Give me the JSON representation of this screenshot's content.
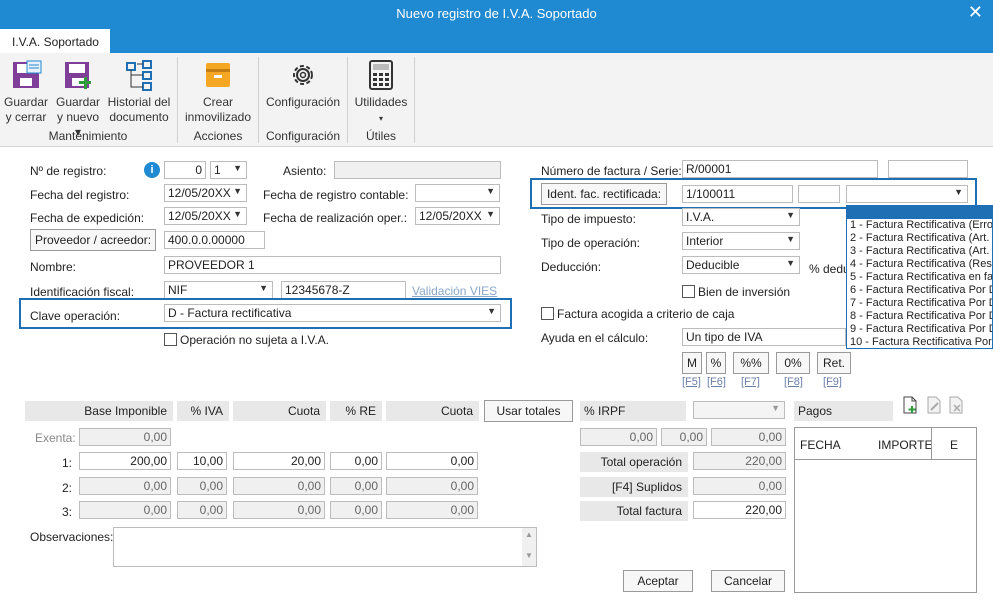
{
  "window": {
    "title": "Nuevo registro de I.V.A. Soportado",
    "close": "✕"
  },
  "tab": "I.V.A. Soportado",
  "ribbon": {
    "buttons": {
      "guardar_cerrar": [
        "Guardar",
        "y cerrar"
      ],
      "guardar_nuevo": [
        "Guardar",
        "y nuevo ▾"
      ],
      "historial": [
        "Historial del",
        "documento"
      ],
      "crear": [
        "Crear",
        "inmovilizado"
      ],
      "configuracion": [
        "Configuración"
      ],
      "utilidades": [
        "Utilidades",
        "▾"
      ]
    },
    "groups": {
      "mantenimiento": "Mantenimiento",
      "acciones": "Acciones",
      "configuracion": "Configuración",
      "utiles": "Útiles"
    }
  },
  "left": {
    "n_registro_label": "Nº de registro:",
    "n_registro_value": "0",
    "n_registro_sel": "1",
    "asiento_label": "Asiento:",
    "fecha_registro_label": "Fecha del registro:",
    "fecha_registro": "12/05/20XX",
    "fecha_contable_label": "Fecha de registro contable:",
    "fecha_expedicion_label": "Fecha de expedición:",
    "fecha_expedicion": "12/05/20XX",
    "fecha_realizacion_label": "Fecha de realización oper.:",
    "fecha_realizacion": "12/05/20XX",
    "proveedor_btn": "Proveedor / acreedor:",
    "proveedor_code": "400.0.0.00000",
    "nombre_label": "Nombre:",
    "nombre": "PROVEEDOR 1",
    "ident_label": "Identificación fiscal:",
    "ident_tipo": "NIF",
    "ident_num": "12345678-Z",
    "validacion": "Validación VIES",
    "clave_label": "Clave operación:",
    "clave_value": "D - Factura rectificativa",
    "no_sujeta": "Operación no sujeta a I.V.A."
  },
  "right": {
    "num_factura_label": "Número de factura / Serie:",
    "num_factura": "R/00001",
    "ident_rect_btn": "Ident. fac. rectificada:",
    "ident_rect_value": "1/100011",
    "tipo_impuesto_label": "Tipo de impuesto:",
    "tipo_impuesto": "I.V.A.",
    "tipo_operacion_label": "Tipo de operación:",
    "tipo_operacion": "Interior",
    "deduccion_label": "Deducción:",
    "deduccion": "Deducible",
    "pct_deduc": "% dedu",
    "bien_inversion": "Bien de inversión",
    "criterio_caja": "Factura acogida a criterio de caja",
    "ayuda_label": "Ayuda en el cálculo:",
    "ayuda_value": "Un tipo de IVA",
    "calc_buttons": [
      "M",
      "%",
      "%%",
      "0%",
      "Ret."
    ],
    "fkeys": [
      "[F5]",
      "[F6]",
      "[F7]",
      "[F8]",
      "[F9]"
    ]
  },
  "dropdown_options": [
    "1 - Factura Rectificativa (Error",
    "2 - Factura Rectificativa (Art.",
    "3 - Factura Rectificativa (Art.",
    "4 - Factura Rectificativa (Resto",
    "5 - Factura Rectificativa en fa",
    "6 - Factura Rectificativa Por D",
    "7 - Factura Rectificativa Por D",
    "8 - Factura Rectificativa Por D",
    "9 - Factura Rectificativa Por D",
    "10 - Factura Rectificativa Por"
  ],
  "table": {
    "headers": {
      "base": "Base Imponible",
      "pct_iva": "% IVA",
      "cuota": "Cuota",
      "pct_re": "% RE",
      "cuota2": "Cuota",
      "usar_totales": "Usar totales",
      "irpf": "% IRPF"
    },
    "exenta_label": "Exenta:",
    "exenta_value": "0,00",
    "rows": [
      {
        "label": "1:",
        "base": "200,00",
        "iva": "10,00",
        "cuota": "20,00",
        "re": "0,00",
        "cuota_re": "0,00"
      },
      {
        "label": "2:",
        "base": "0,00",
        "iva": "0,00",
        "cuota": "0,00",
        "re": "0,00",
        "cuota_re": "0,00"
      },
      {
        "label": "3:",
        "base": "0,00",
        "iva": "0,00",
        "cuota": "0,00",
        "re": "0,00",
        "cuota_re": "0,00"
      }
    ],
    "irpf_values": [
      "0,00",
      "0,00",
      "0,00"
    ],
    "total_operacion_label": "Total operación",
    "total_operacion": "220,00",
    "suplidos_label": "[F4] Suplidos",
    "suplidos": "0,00",
    "total_factura_label": "Total factura",
    "total_factura": "220,00"
  },
  "pagos": {
    "title": "Pagos",
    "cols": [
      "FECHA",
      "IMPORTE",
      "E"
    ]
  },
  "observaciones_label": "Observaciones:",
  "footer": {
    "aceptar": "Aceptar",
    "cancelar": "Cancelar"
  },
  "colors": {
    "titlebar": "#1f8ad2",
    "highlight": "#1f6fb5",
    "info": "#1f8ad2"
  }
}
